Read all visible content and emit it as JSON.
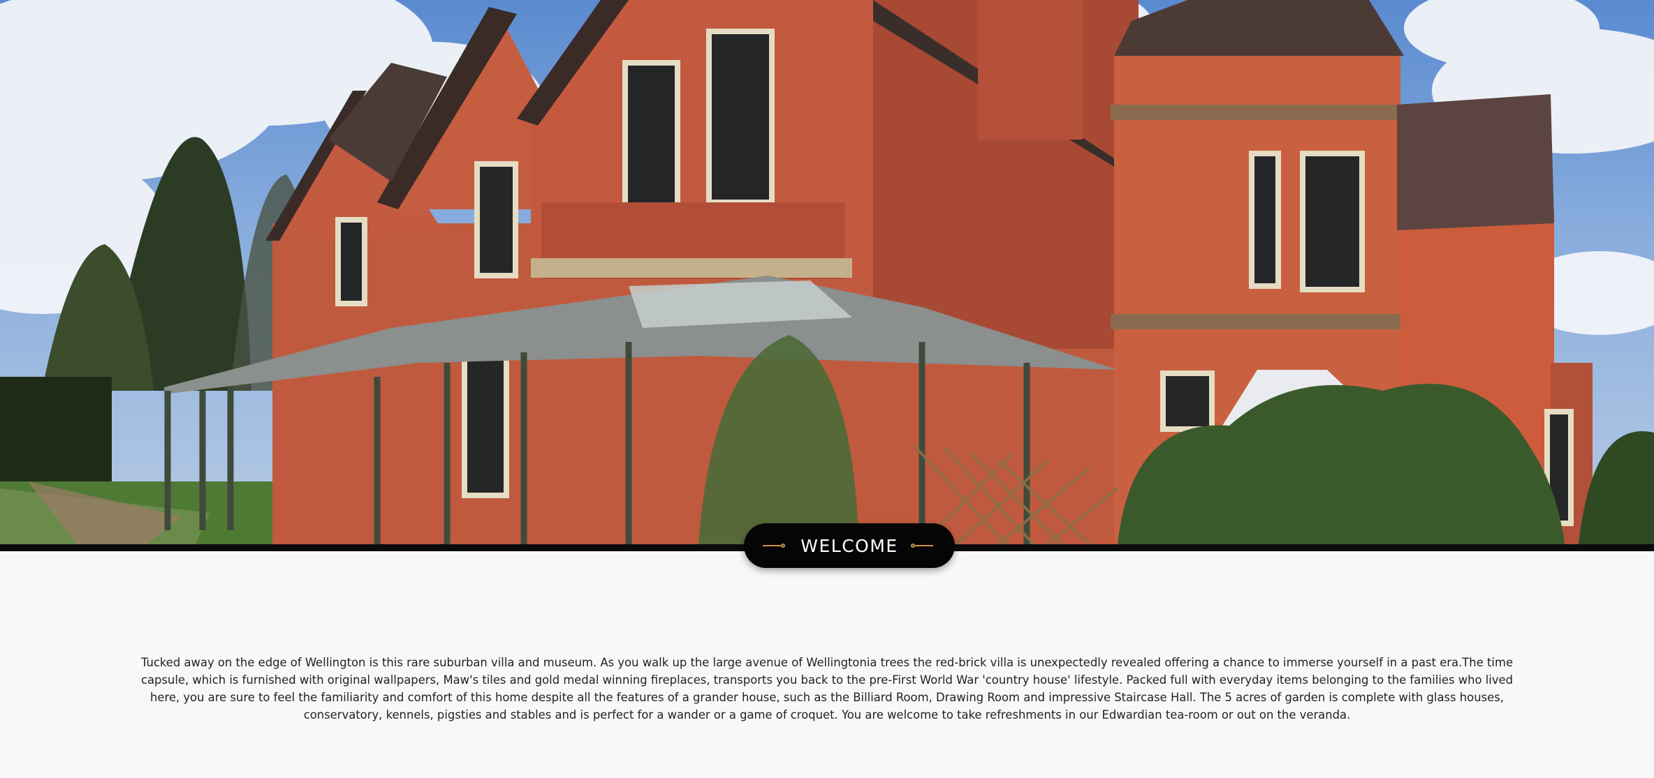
{
  "hero": {
    "image_alt": "Red-brick Victorian villa with glass veranda and gardens"
  },
  "welcome": {
    "label": "WELCOME",
    "accent_color": "#c9934a",
    "badge_color": "#050505"
  },
  "intro": {
    "text": "Tucked away on the edge of Wellington is this rare suburban villa and museum. As you walk up the large avenue of Wellingtonia trees the red-brick villa is unexpectedly revealed offering a chance to immerse yourself in a past era.The time capsule, which is furnished with original wallpapers, Maw's tiles and gold medal winning fireplaces, transports you back to the pre-First World War 'country house' lifestyle. Packed full with everyday items belonging to the families who lived here, you are sure to feel the familiarity and comfort of this home despite all the features of a grander house, such as the Billiard Room, Drawing Room and impressive Staircase Hall. The 5 acres of garden is complete with glass houses, conservatory, kennels, pigsties and stables and is perfect for a wander or a game of croquet. You are welcome to take refreshments in our Edwardian tea-room or out on the veranda."
  }
}
